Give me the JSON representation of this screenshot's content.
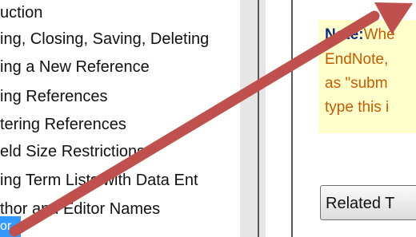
{
  "nav": {
    "items": [
      {
        "label": "uction"
      },
      {
        "label": "ing, Closing, Saving, Deleting"
      },
      {
        "label": "ing a New Reference"
      },
      {
        "label": "ing References"
      },
      {
        "label": "tering References"
      },
      {
        "label": "eld Size Restrictions"
      },
      {
        "label": "ing Term Lists with Data Ent"
      },
      {
        "label": "thor and Editor Names"
      },
      {
        "label": "or"
      }
    ]
  },
  "note": {
    "label": "Note:",
    "lines": [
      "Whe",
      "EndNote,",
      "as \"subm",
      "type this i"
    ]
  },
  "buttons": {
    "related": "Related T"
  },
  "colors": {
    "arrow": "#c0504d",
    "note_bg": "#ffffcc",
    "selected": "#3399ff"
  }
}
